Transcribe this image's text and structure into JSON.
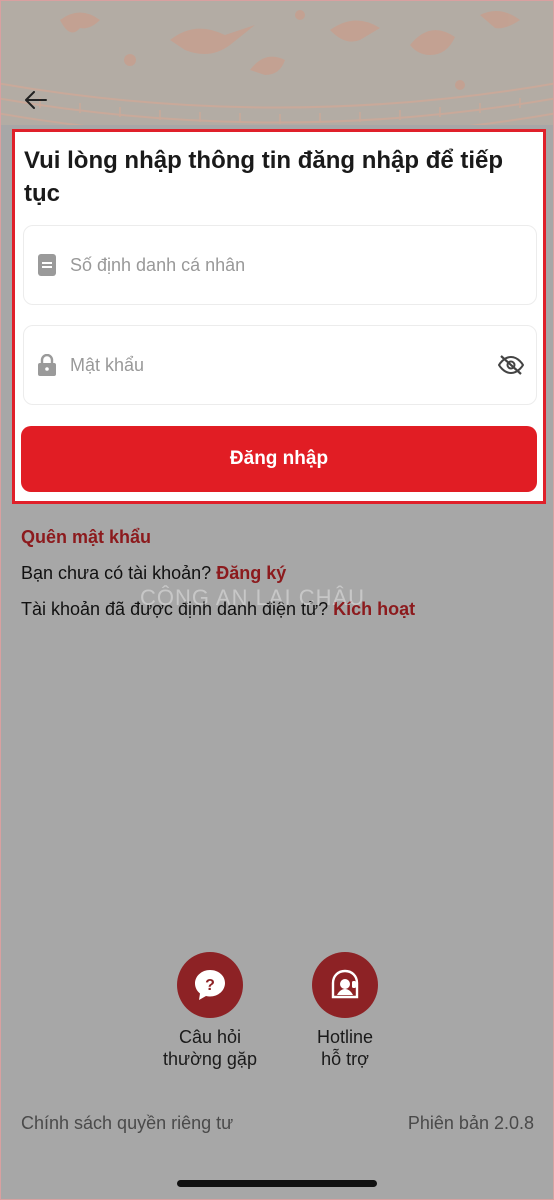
{
  "header": {
    "back_icon": "arrow-left-icon"
  },
  "login": {
    "title": "Vui lòng nhập thông tin đăng nhập để tiếp tục",
    "id_field": {
      "placeholder": "Số định danh cá nhân",
      "value": "",
      "icon": "id-card-icon"
    },
    "password_field": {
      "placeholder": "Mật khẩu",
      "value": "",
      "icon": "lock-icon",
      "toggle_icon": "eye-off-icon"
    },
    "submit_label": "Đăng nhập"
  },
  "links": {
    "forgot_password": "Quên mật khẩu",
    "no_account_text": "Bạn chưa có tài khoản?",
    "register_label": "Đăng ký",
    "identified_text": "Tài khoản đã được định danh điện tử?",
    "activate_label": "Kích hoạt"
  },
  "watermark": "CÔNG AN LAI CHÂU",
  "support": {
    "faq_label": "Câu hỏi thường gặp",
    "faq_icon": "question-bubble-icon",
    "hotline_label": "Hotline hỗ trợ",
    "hotline_icon": "headset-agent-icon"
  },
  "footer": {
    "privacy_label": "Chính sách quyền riêng tư",
    "version_text": "Phiên bản 2.0.8"
  },
  "colors": {
    "primary": "#e11d24",
    "link_dark_red": "#8c1a1d",
    "icon_circle": "#8d2225"
  }
}
